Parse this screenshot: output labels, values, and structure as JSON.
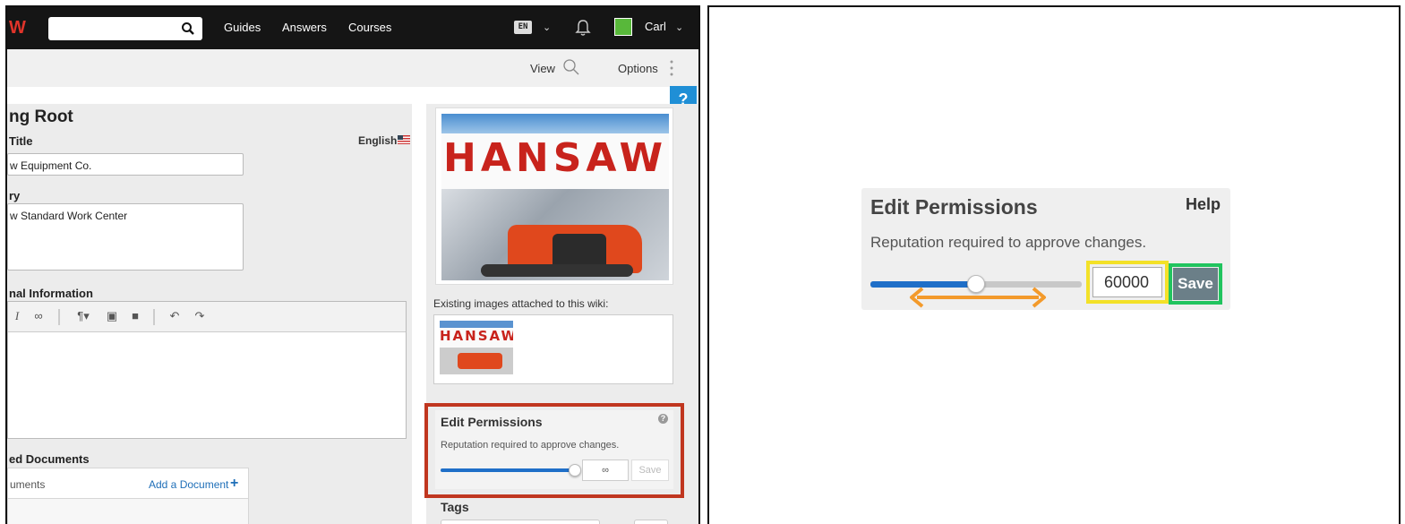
{
  "nav": {
    "logo_fragment": "W",
    "links": [
      "Guides",
      "Answers",
      "Courses"
    ],
    "language": "EN",
    "user_name": "Carl"
  },
  "subbar": {
    "view_label": "View",
    "options_label": "Options",
    "help_tab": "?"
  },
  "form": {
    "title": "ng Root",
    "title_label": "Title",
    "language_label": "English",
    "title_value": "w Equipment Co.",
    "summary_label": "ry",
    "summary_value": "w Standard Work Center",
    "info_label": "nal Information",
    "docs_label": "ed Documents",
    "docs_header_fragment": "uments",
    "add_document": "Add a Document"
  },
  "sidebar": {
    "hero_word": "HANSAW",
    "images_caption": "Existing images attached to this wiki:",
    "thumb_word": "HANSAW"
  },
  "edit_permissions_small": {
    "title": "Edit Permissions",
    "help_icon": "?",
    "description": "Reputation required to approve changes.",
    "value": "∞",
    "save": "Save",
    "slider_fraction": 1.0
  },
  "tags": {
    "label": "Tags"
  },
  "edit_permissions_zoom": {
    "title": "Edit Permissions",
    "help": "Help",
    "description": "Reputation required to approve changes.",
    "value": "60000",
    "save": "Save",
    "slider_fraction": 0.5
  },
  "colors": {
    "highlight_red": "#c0361f",
    "highlight_yellow": "#f3e128",
    "highlight_green": "#21c45f",
    "arrow_orange": "#f39a2b",
    "slider_blue": "#1f6fc8"
  }
}
